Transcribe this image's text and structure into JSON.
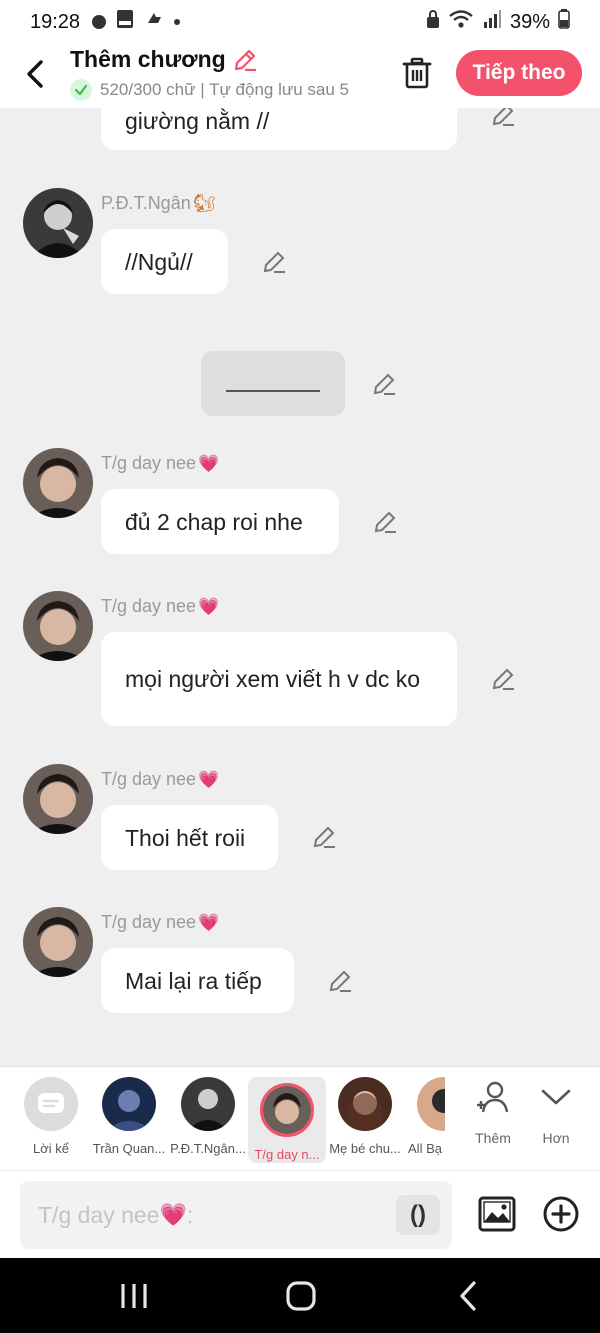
{
  "status_bar": {
    "time": "19:28",
    "battery": "39%"
  },
  "header": {
    "title": "Thêm chương",
    "subtitle": "520/300 chữ | Tự động lưu sau 5",
    "next_label": "Tiếp theo"
  },
  "messages": [
    {
      "name": "",
      "text": "giường nằm //"
    },
    {
      "name": "P.Đ.T.Ngân",
      "text": "//Ngủ//"
    },
    {
      "name": "",
      "text": "________"
    },
    {
      "name": "T/g day nee",
      "text": "đủ 2 chap roi nhe"
    },
    {
      "name": "T/g day nee",
      "text": "mọi người xem viết h v dc ko"
    },
    {
      "name": "T/g day nee",
      "text": "Thoi hết roii"
    },
    {
      "name": "T/g day nee",
      "text": "Mai lại ra tiếp"
    }
  ],
  "characters": [
    {
      "label": "Lời kể"
    },
    {
      "label": "Trần Quan..."
    },
    {
      "label": "P.Đ.T.Ngân..."
    },
    {
      "label": "T/g day n..."
    },
    {
      "label": "Mẹ bé chu..."
    },
    {
      "label": "All Bạ"
    }
  ],
  "char_actions": {
    "more": "Thêm",
    "less": "Hơn"
  },
  "composer": {
    "placeholder": "T/g day nee",
    "paren_label": "()"
  },
  "colors": {
    "accent": "#f4516c",
    "heart": "#ff3d8f",
    "selected_text": "#e94a63"
  }
}
